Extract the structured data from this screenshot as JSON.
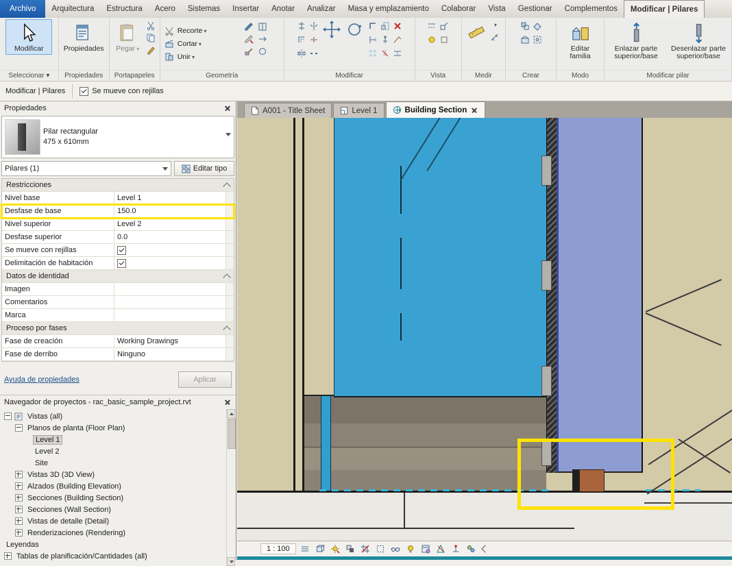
{
  "ribbon_tabs": {
    "file": "Archivo",
    "items": [
      "Arquitectura",
      "Estructura",
      "Acero",
      "Sistemas",
      "Insertar",
      "Anotar",
      "Analizar",
      "Masa y emplazamiento",
      "Colaborar",
      "Vista",
      "Gestionar",
      "Complementos"
    ],
    "contextual": "Modificar | Pilares"
  },
  "ribbon": {
    "groups": {
      "seleccionar": {
        "label": "Seleccionar ▾",
        "modificar": "Modificar"
      },
      "propiedades": {
        "label": "Propiedades",
        "button": "Propiedades"
      },
      "portapapeles": {
        "label": "Portapapeles",
        "pegar": "Pegar"
      },
      "geometria": {
        "label": "Geometría",
        "recorte": "Recorte",
        "cortar": "Cortar",
        "unir": "Unir"
      },
      "modificar": {
        "label": "Modificar",
        "icons": [
          "alinear",
          "desfase",
          "simetria-eje",
          "simetria-dibujar",
          "dividir-elemento",
          "dividir-con-hueco",
          "mover",
          "rotar",
          "recortar-esquina",
          "recortar-extender",
          "matriz",
          "escala",
          "anclar",
          "desanclar",
          "eliminar"
        ]
      },
      "vista": {
        "label": "Vista",
        "icons": [
          "lineas-ocultas",
          "mostrar-lineas-ocultas",
          "desplazar-elementos",
          "restablecer-vista"
        ]
      },
      "medir": {
        "label": "Medir",
        "icons": [
          "medir-regla",
          "cota-alineada"
        ]
      },
      "crear": {
        "label": "Crear",
        "icons": [
          "crear-similar",
          "montaje",
          "pieza",
          "grupo"
        ]
      },
      "modo": {
        "label": "Modo",
        "editar_familia": "Editar familia"
      },
      "modificar_pilar": {
        "label": "Modificar pilar",
        "enlazar": "Enlazar parte superior/base",
        "desenlazar": "Desenlazar parte superior/base"
      }
    }
  },
  "options_bar": {
    "context": "Modificar | Pilares",
    "moves_with_grids": "Se mueve con rejillas",
    "moves_with_grids_checked": true
  },
  "properties": {
    "title": "Propiedades",
    "type_name": "Pilar rectangular",
    "type_size": "475 x 610mm",
    "selector": "Pilares (1)",
    "edit_type": "Editar tipo",
    "rows": [
      {
        "kind": "section",
        "label": "Restricciones"
      },
      {
        "kind": "text",
        "label": "Nivel base",
        "value": "Level 1"
      },
      {
        "kind": "text",
        "label": "Desfase de base",
        "value": "150.0",
        "highlight": true
      },
      {
        "kind": "text",
        "label": "Nivel superior",
        "value": "Level 2"
      },
      {
        "kind": "text",
        "label": "Desfase superior",
        "value": "0.0"
      },
      {
        "kind": "check",
        "label": "Se mueve con rejillas",
        "checked": true
      },
      {
        "kind": "check",
        "label": "Delimitación de habitación",
        "checked": true
      },
      {
        "kind": "section",
        "label": "Datos de identidad"
      },
      {
        "kind": "text",
        "label": "Imagen",
        "value": ""
      },
      {
        "kind": "text",
        "label": "Comentarios",
        "value": ""
      },
      {
        "kind": "text",
        "label": "Marca",
        "value": ""
      },
      {
        "kind": "section",
        "label": "Proceso por fases"
      },
      {
        "kind": "text",
        "label": "Fase de creación",
        "value": "Working Drawings"
      },
      {
        "kind": "text",
        "label": "Fase de derribo",
        "value": "Ninguno"
      }
    ],
    "help_link": "Ayuda de propiedades",
    "apply": "Aplicar"
  },
  "browser": {
    "title": "Navegador de proyectos - rac_basic_sample_project.rvt",
    "items": [
      {
        "label": "Vistas (all)",
        "depth": 0,
        "expander": "minus"
      },
      {
        "label": "Planos de planta (Floor Plan)",
        "depth": 1,
        "expander": "minus"
      },
      {
        "label": "Level 1",
        "depth": 2,
        "selected": true
      },
      {
        "label": "Level 2",
        "depth": 2
      },
      {
        "label": "Site",
        "depth": 2
      },
      {
        "label": "Vistas 3D (3D View)",
        "depth": 1,
        "expander": "plus"
      },
      {
        "label": "Alzados (Building Elevation)",
        "depth": 1,
        "expander": "plus"
      },
      {
        "label": "Secciones (Building Section)",
        "depth": 1,
        "expander": "plus"
      },
      {
        "label": "Secciones (Wall Section)",
        "depth": 1,
        "expander": "plus"
      },
      {
        "label": "Vistas de detalle (Detail)",
        "depth": 1,
        "expander": "plus"
      },
      {
        "label": "Renderizaciones (Rendering)",
        "depth": 1,
        "expander": "plus"
      },
      {
        "label": "Leyendas",
        "depth": 0
      },
      {
        "label": "Tablas de planificación/Cantidades (all)",
        "depth": 0,
        "expander": "plus"
      }
    ]
  },
  "view_tabs": [
    {
      "label": "A001 - Title Sheet",
      "active": false
    },
    {
      "label": "Level 1",
      "active": false
    },
    {
      "label": "Building Section",
      "active": true
    }
  ],
  "status_bar": {
    "scale": "1 : 100",
    "icons": [
      "detail-level",
      "visual-style",
      "sun-path",
      "shadows",
      "crop-view",
      "show-crop-region",
      "temporary-hide-isolate",
      "reveal-hidden-elements",
      "temporary-view-properties",
      "hide-analytical-model",
      "reveal-constraints",
      "worksharing-display"
    ]
  },
  "colors": {
    "highlight_yellow": "#ffe203",
    "glass_blue": "#3aa2d3",
    "mullion_periwinkle": "#8d9cd2",
    "wall_tan": "#d3caa8",
    "column_brown": "#a9643c",
    "file_tab_blue": "#1c5aa8",
    "selection_blue": "#cfe3f7"
  }
}
